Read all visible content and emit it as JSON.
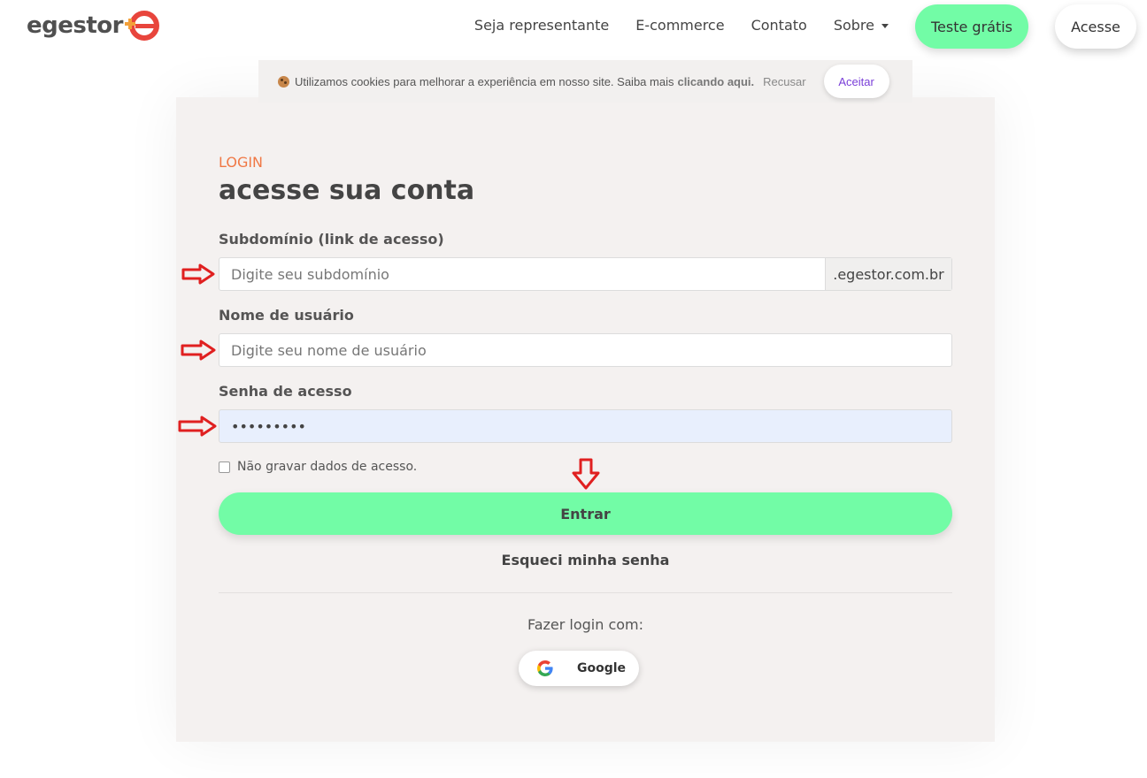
{
  "header": {
    "logo_text": "egestor",
    "nav": [
      {
        "label": "Seja representante"
      },
      {
        "label": "E-commerce"
      },
      {
        "label": "Contato"
      },
      {
        "label": "Sobre"
      }
    ],
    "trial_label": "Teste grátis",
    "access_label": "Acesse"
  },
  "cookie": {
    "text": "Utilizamos cookies para melhorar a experiência em nosso site. Saiba mais",
    "link": "clicando aqui.",
    "decline": "Recusar",
    "accept": "Aceitar"
  },
  "login": {
    "eyebrow": "LOGIN",
    "title": "acesse sua conta",
    "subdomain_label": "Subdomínio (link de acesso)",
    "subdomain_placeholder": "Digite seu subdomínio",
    "subdomain_suffix": ".egestor.com.br",
    "username_label": "Nome de usuário",
    "username_placeholder": "Digite seu nome de usuário",
    "password_label": "Senha de acesso",
    "password_value": "•••••••••",
    "remember_label": "Não gravar dados de acesso.",
    "submit_label": "Entrar",
    "forgot_label": "Esqueci minha senha",
    "social_label": "Fazer login com:",
    "google_label": "Google"
  },
  "colors": {
    "accent_green": "#72fca6",
    "eyebrow_orange": "#f07845",
    "arrow_red": "#e02020",
    "card_bg": "#f4f1f0"
  }
}
